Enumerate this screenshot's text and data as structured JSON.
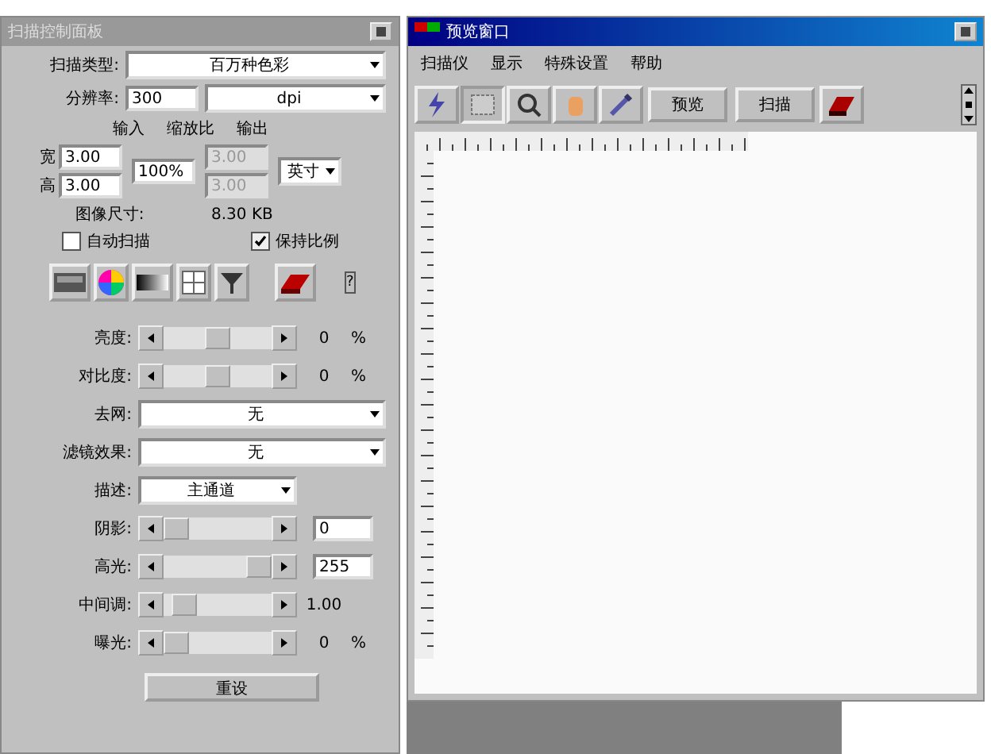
{
  "control_panel": {
    "title": "扫描控制面板",
    "scan_type": {
      "label": "扫描类型:",
      "value": "百万种色彩"
    },
    "resolution": {
      "label": "分辨率:",
      "value": "300",
      "unit": "dpi"
    },
    "size_headers": [
      "输入",
      "缩放比",
      "输出"
    ],
    "width": {
      "label": "宽",
      "input": "3.00",
      "output": "3.00"
    },
    "height": {
      "label": "高",
      "input": "3.00",
      "output": "3.00"
    },
    "scale": "100%",
    "units": "英寸",
    "image_size": {
      "label": "图像尺寸:",
      "value": "8.30 KB"
    },
    "checkboxes": [
      {
        "label": "自动扫描",
        "checked": false
      },
      {
        "label": "保持比例",
        "checked": true
      }
    ],
    "help": "?",
    "adjustments": [
      {
        "kind": "slider",
        "label": "亮度:",
        "level": 0.5,
        "reading": "0",
        "unit": "%"
      },
      {
        "kind": "slider",
        "label": "对比度:",
        "level": 0.5,
        "reading": "0",
        "unit": "%"
      },
      {
        "kind": "dropdown",
        "label": "去网:",
        "value": "无"
      },
      {
        "kind": "dropdown",
        "label": "滤镜效果:",
        "value": "无"
      },
      {
        "kind": "short_dropdown",
        "label": "描述:",
        "value": "主通道"
      },
      {
        "kind": "slider_field",
        "label": "阴影:",
        "level": 0.0,
        "reading": "0"
      },
      {
        "kind": "slider_field",
        "label": "高光:",
        "level": 1.0,
        "reading": "255"
      },
      {
        "kind": "slider",
        "label": "中间调:",
        "level": 0.1,
        "reading": "1.00"
      },
      {
        "kind": "slider",
        "label": "曝光:",
        "level": 0.0,
        "reading": "0",
        "unit": "%"
      }
    ],
    "reset_button": "重设"
  },
  "preview_window": {
    "title": "预览窗口",
    "menu": [
      "扫描仪",
      "显示",
      "特殊设置",
      "帮助"
    ],
    "buttons": [
      "预览",
      "扫描"
    ]
  }
}
